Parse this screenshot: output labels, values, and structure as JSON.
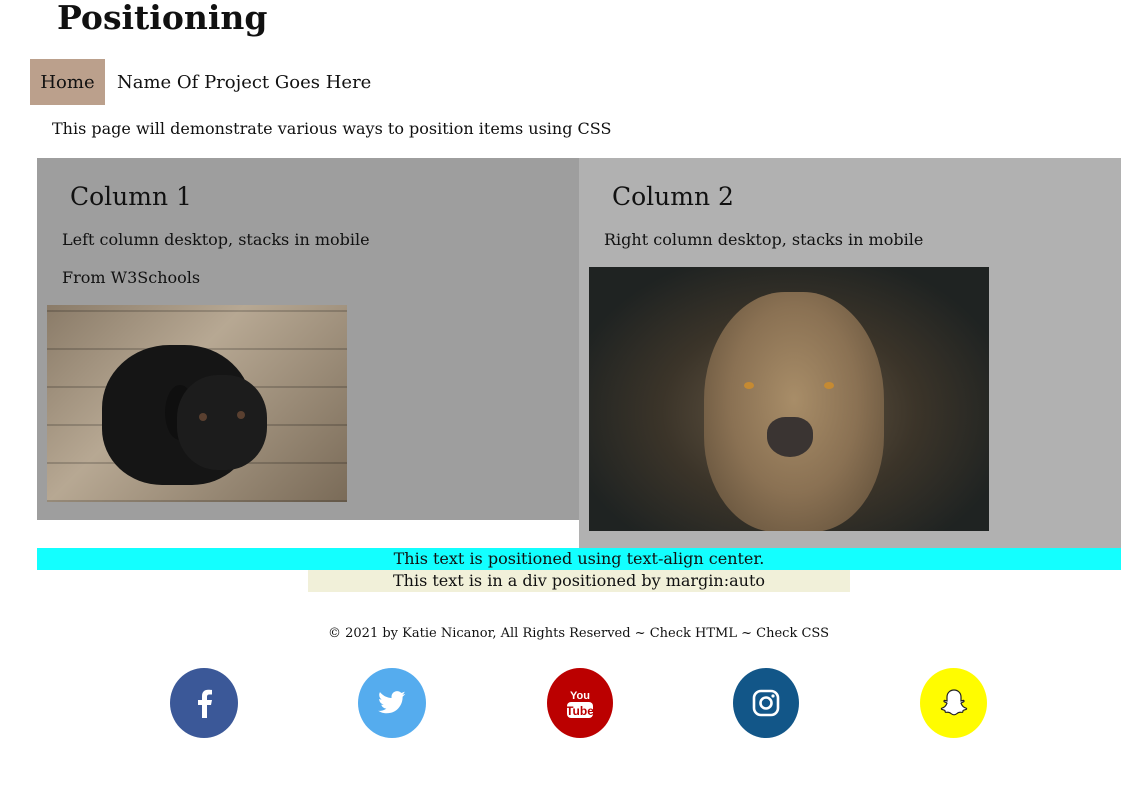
{
  "page": {
    "title": "Positioning",
    "intro": "This page will demonstrate various ways to position items using CSS"
  },
  "nav": {
    "home": "Home",
    "project": "Name Of Project Goes Here",
    "active_color": "#bba08c"
  },
  "columns": [
    {
      "heading": "Column 1",
      "text": "Left column desktop, stacks in mobile",
      "source": "From W3Schools",
      "image": "black-puppy-photo",
      "background": "#9e9e9e"
    },
    {
      "heading": "Column 2",
      "text": "Right column desktop, stacks in mobile",
      "image": "lioness-photo",
      "background": "#b1b1b1"
    }
  ],
  "positioned": {
    "center_text": "This text is positioned using text-align center.",
    "center_bg": "#13ffff",
    "margin_text": "This text is in a div positioned by margin:auto",
    "margin_bg": "#f1f0d9"
  },
  "footer": {
    "copyright": "© 2021 by Katie Nicanor, All Rights Reserved ~ ",
    "check_html": "Check HTML",
    "separator": " ~ ",
    "check_css": "Check CSS"
  },
  "social": [
    {
      "name": "facebook-icon",
      "color": "#3b5898"
    },
    {
      "name": "twitter-icon",
      "color": "#55acee"
    },
    {
      "name": "youtube-icon",
      "color": "#bb0000"
    },
    {
      "name": "instagram-icon",
      "color": "#125688"
    },
    {
      "name": "snapchat-icon",
      "color": "#fffc00"
    }
  ]
}
